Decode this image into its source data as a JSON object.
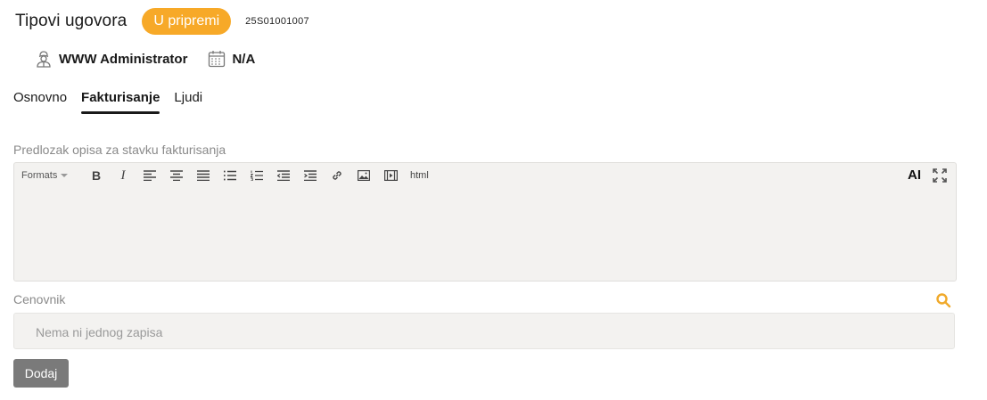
{
  "header": {
    "title": "Tipovi ugovora",
    "status_badge": "U pripremi",
    "document_number": "25S01001007"
  },
  "meta": {
    "user": {
      "icon": "user-icon",
      "label": "WWW Administrator"
    },
    "date": {
      "icon": "calendar-icon",
      "label": "N/A"
    }
  },
  "tabs": [
    {
      "label": "Osnovno",
      "active": false
    },
    {
      "label": "Fakturisanje",
      "active": true
    },
    {
      "label": "Ljudi",
      "active": false
    }
  ],
  "editor": {
    "label": "Predlozak opisa za stavku fakturisanja",
    "toolbar": {
      "formats_label": "Formats",
      "buttons": [
        "bold",
        "italic",
        "align-left",
        "align-center",
        "align-justify",
        "bullet-list",
        "numbered-list",
        "outdent",
        "indent",
        "link",
        "image",
        "media"
      ],
      "html_label": "html",
      "ai_label": "AI",
      "fullscreen_icon": "fullscreen-icon"
    },
    "value": ""
  },
  "price_list": {
    "label": "Cenovnik",
    "search_icon": "search-icon",
    "empty_text": "Nema ni jednog zapisa"
  },
  "actions": {
    "add_label": "Dodaj"
  },
  "colors": {
    "badge": "#f7a928",
    "search_icon": "#f0a92a",
    "add_button": "#7a7a7a",
    "field_background": "#f3f2f0"
  }
}
